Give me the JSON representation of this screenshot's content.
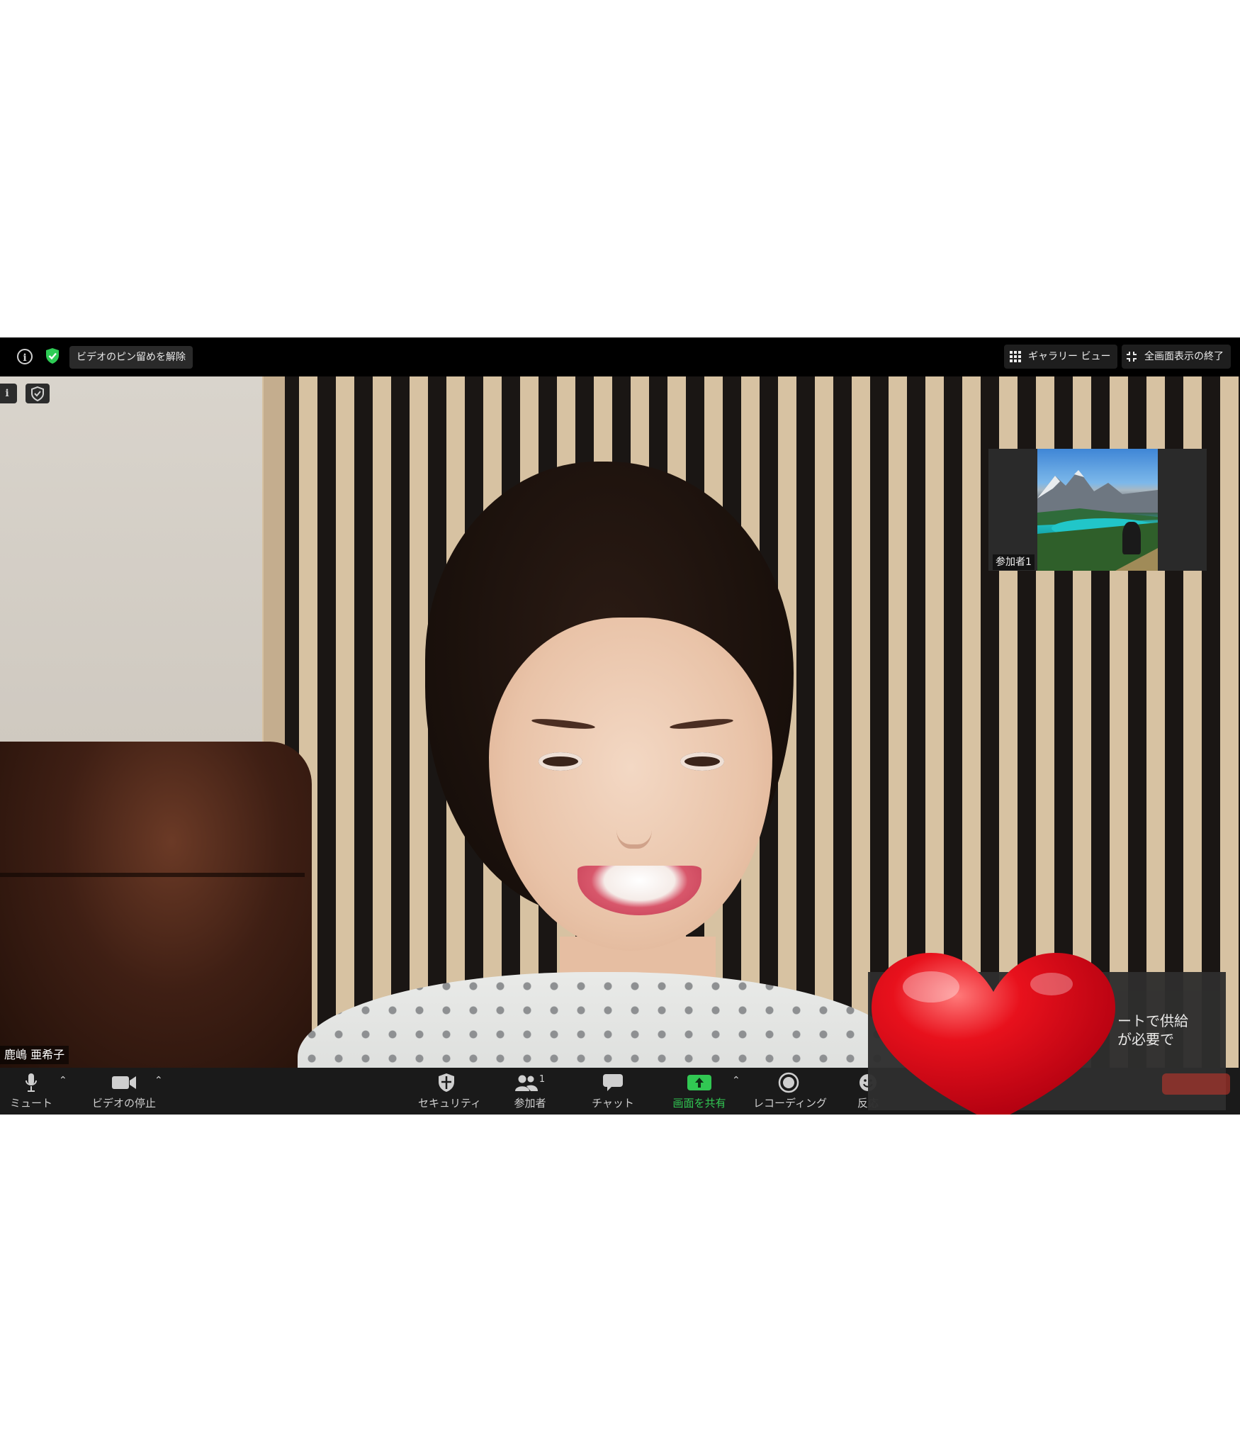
{
  "top_bar": {
    "pin_label": "ビデオのピン留めを解除",
    "gallery_label": "ギャラリー ビュー",
    "exit_fullscreen_label": "全画面表示の終了"
  },
  "main_video": {
    "participant_name": "鹿嶋 亜希子"
  },
  "thumbnail": {
    "participant_name": "参加者1"
  },
  "notification": {
    "text": "ートで供給\nが必要で"
  },
  "toolbar": {
    "mute": "ミュート",
    "stop_video": "ビデオの停止",
    "security": "セキュリティ",
    "participants": "参加者",
    "participant_count": "1",
    "chat": "チャット",
    "share_screen": "画面を共有",
    "recording": "レコーディング",
    "reactions": "反応"
  },
  "colors": {
    "share_green": "#31c853",
    "shield_green": "#2ecc55",
    "heart_red": "#e0141e",
    "toolbar_bg": "#1a1a1a"
  }
}
